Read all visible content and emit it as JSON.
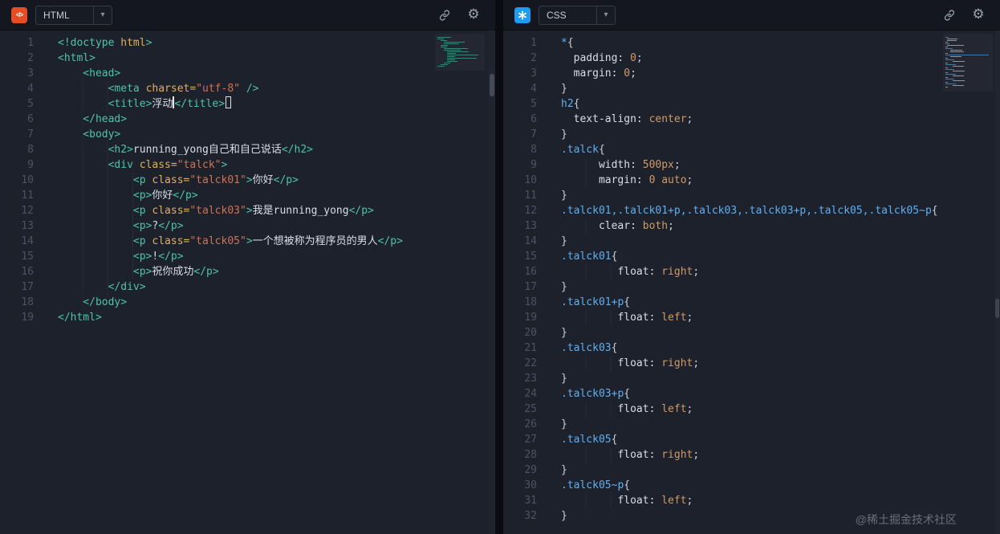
{
  "watermark": "@稀土掘金技术社区",
  "colors": {
    "editor_bg": "#1d212b",
    "header_bg": "#14171f",
    "splitter": "#0a0c11",
    "html_icon_bg": "#e44d26",
    "css_icon_bg": "#1f9cf0",
    "line_number": "#4b5364",
    "tokens": {
      "tag": "#4fc3a8",
      "attr": "#e0b05e",
      "str": "#ce7354",
      "text": "#d8dde8",
      "sel": "#61afef",
      "prop": "#d8dde8",
      "val": "#d19a66",
      "punc": "#c8cfdb"
    }
  },
  "icons": {
    "chevron": "▾",
    "gear": "⚙",
    "html_glyph": "</>"
  },
  "left_panel": {
    "header": {
      "language_label": "HTML"
    },
    "code_lines": [
      {
        "indent": 0,
        "tokens": [
          {
            "t": "tag",
            "s": "<!doctype "
          },
          {
            "t": "attr",
            "s": "html"
          },
          {
            "t": "tag",
            "s": ">"
          }
        ]
      },
      {
        "indent": 0,
        "tokens": [
          {
            "t": "tag",
            "s": "<html>"
          }
        ]
      },
      {
        "indent": 4,
        "tokens": [
          {
            "t": "tag",
            "s": "<head>"
          }
        ]
      },
      {
        "indent": 8,
        "tokens": [
          {
            "t": "tag",
            "s": "<meta "
          },
          {
            "t": "attr",
            "s": "charset="
          },
          {
            "t": "str",
            "s": "\"utf-8\""
          },
          {
            "t": "tag",
            "s": " />"
          }
        ]
      },
      {
        "indent": 8,
        "tokens": [
          {
            "t": "tag",
            "s": "<title>"
          },
          {
            "t": "text",
            "s": "浮动"
          },
          {
            "t": "caret"
          },
          {
            "t": "tag",
            "s": "</title>"
          },
          {
            "t": "cursorbox"
          }
        ]
      },
      {
        "indent": 4,
        "tokens": [
          {
            "t": "tag",
            "s": "</head>"
          }
        ]
      },
      {
        "indent": 4,
        "tokens": [
          {
            "t": "tag",
            "s": "<body>"
          }
        ]
      },
      {
        "indent": 8,
        "tokens": [
          {
            "t": "tag",
            "s": "<h2>"
          },
          {
            "t": "text",
            "s": "running_yong自己和自己说话"
          },
          {
            "t": "tag",
            "s": "</h2>"
          }
        ]
      },
      {
        "indent": 8,
        "tokens": [
          {
            "t": "tag",
            "s": "<div "
          },
          {
            "t": "attr",
            "s": "class="
          },
          {
            "t": "str",
            "s": "\"talck\""
          },
          {
            "t": "tag",
            "s": ">"
          }
        ]
      },
      {
        "indent": 12,
        "tokens": [
          {
            "t": "tag",
            "s": "<p "
          },
          {
            "t": "attr",
            "s": "class="
          },
          {
            "t": "str",
            "s": "\"talck01\""
          },
          {
            "t": "tag",
            "s": ">"
          },
          {
            "t": "text",
            "s": "你好"
          },
          {
            "t": "tag",
            "s": "</p>"
          }
        ]
      },
      {
        "indent": 12,
        "tokens": [
          {
            "t": "tag",
            "s": "<p>"
          },
          {
            "t": "text",
            "s": "你好"
          },
          {
            "t": "tag",
            "s": "</p>"
          }
        ]
      },
      {
        "indent": 12,
        "tokens": [
          {
            "t": "tag",
            "s": "<p "
          },
          {
            "t": "attr",
            "s": "class="
          },
          {
            "t": "str",
            "s": "\"talck03\""
          },
          {
            "t": "tag",
            "s": ">"
          },
          {
            "t": "text",
            "s": "我是running_yong"
          },
          {
            "t": "tag",
            "s": "</p>"
          }
        ]
      },
      {
        "indent": 12,
        "tokens": [
          {
            "t": "tag",
            "s": "<p>"
          },
          {
            "t": "text",
            "s": "?"
          },
          {
            "t": "tag",
            "s": "</p>"
          }
        ]
      },
      {
        "indent": 12,
        "tokens": [
          {
            "t": "tag",
            "s": "<p "
          },
          {
            "t": "attr",
            "s": "class="
          },
          {
            "t": "str",
            "s": "\"talck05\""
          },
          {
            "t": "tag",
            "s": ">"
          },
          {
            "t": "text",
            "s": "一个想被称为程序员的男人"
          },
          {
            "t": "tag",
            "s": "</p>"
          }
        ]
      },
      {
        "indent": 12,
        "tokens": [
          {
            "t": "tag",
            "s": "<p>"
          },
          {
            "t": "text",
            "s": "!"
          },
          {
            "t": "tag",
            "s": "</p>"
          }
        ]
      },
      {
        "indent": 12,
        "tokens": [
          {
            "t": "tag",
            "s": "<p>"
          },
          {
            "t": "text",
            "s": "祝你成功"
          },
          {
            "t": "tag",
            "s": "</p>"
          }
        ]
      },
      {
        "indent": 8,
        "tokens": [
          {
            "t": "tag",
            "s": "</div>"
          }
        ]
      },
      {
        "indent": 4,
        "tokens": [
          {
            "t": "tag",
            "s": "</body>"
          }
        ]
      },
      {
        "indent": 0,
        "tokens": [
          {
            "t": "tag",
            "s": "</html>"
          }
        ]
      }
    ]
  },
  "right_panel": {
    "header": {
      "language_label": "CSS"
    },
    "code_lines": [
      {
        "indent": 0,
        "tokens": [
          {
            "t": "sel",
            "s": "*"
          },
          {
            "t": "punc",
            "s": "{"
          }
        ]
      },
      {
        "indent": 2,
        "tokens": [
          {
            "t": "prop",
            "s": "padding: "
          },
          {
            "t": "val",
            "s": "0"
          },
          {
            "t": "punc",
            "s": ";"
          }
        ]
      },
      {
        "indent": 2,
        "tokens": [
          {
            "t": "prop",
            "s": "margin: "
          },
          {
            "t": "val",
            "s": "0"
          },
          {
            "t": "punc",
            "s": ";"
          }
        ]
      },
      {
        "indent": 0,
        "tokens": [
          {
            "t": "punc",
            "s": "}"
          }
        ]
      },
      {
        "indent": 0,
        "tokens": [
          {
            "t": "sel",
            "s": "h2"
          },
          {
            "t": "punc",
            "s": "{"
          }
        ]
      },
      {
        "indent": 2,
        "tokens": [
          {
            "t": "prop",
            "s": "text-align: "
          },
          {
            "t": "val",
            "s": "center"
          },
          {
            "t": "punc",
            "s": ";"
          }
        ]
      },
      {
        "indent": 0,
        "tokens": [
          {
            "t": "punc",
            "s": "}"
          }
        ]
      },
      {
        "indent": 0,
        "tokens": [
          {
            "t": "sel",
            "s": ".talck"
          },
          {
            "t": "punc",
            "s": "{"
          }
        ]
      },
      {
        "indent": 6,
        "tokens": [
          {
            "t": "prop",
            "s": "width: "
          },
          {
            "t": "val",
            "s": "500px"
          },
          {
            "t": "punc",
            "s": ";"
          }
        ]
      },
      {
        "indent": 6,
        "tokens": [
          {
            "t": "prop",
            "s": "margin: "
          },
          {
            "t": "val",
            "s": "0 auto"
          },
          {
            "t": "punc",
            "s": ";"
          }
        ]
      },
      {
        "indent": 0,
        "tokens": [
          {
            "t": "punc",
            "s": "}"
          }
        ]
      },
      {
        "indent": 0,
        "tokens": [
          {
            "t": "sel",
            "s": ".talck01,.talck01+p,.talck03,.talck03+p,.talck05,.talck05~p"
          },
          {
            "t": "punc",
            "s": "{"
          }
        ]
      },
      {
        "indent": 6,
        "tokens": [
          {
            "t": "prop",
            "s": "clear: "
          },
          {
            "t": "val",
            "s": "both"
          },
          {
            "t": "punc",
            "s": ";"
          }
        ]
      },
      {
        "indent": 0,
        "tokens": [
          {
            "t": "punc",
            "s": "}"
          }
        ]
      },
      {
        "indent": 0,
        "tokens": [
          {
            "t": "sel",
            "s": ".talck01"
          },
          {
            "t": "punc",
            "s": "{"
          }
        ]
      },
      {
        "indent": 9,
        "tokens": [
          {
            "t": "prop",
            "s": "float: "
          },
          {
            "t": "val",
            "s": "right"
          },
          {
            "t": "punc",
            "s": ";"
          }
        ]
      },
      {
        "indent": 0,
        "tokens": [
          {
            "t": "punc",
            "s": "}"
          }
        ]
      },
      {
        "indent": 0,
        "tokens": [
          {
            "t": "sel",
            "s": ".talck01+p"
          },
          {
            "t": "punc",
            "s": "{"
          }
        ]
      },
      {
        "indent": 9,
        "tokens": [
          {
            "t": "prop",
            "s": "float: "
          },
          {
            "t": "val",
            "s": "left"
          },
          {
            "t": "punc",
            "s": ";"
          }
        ]
      },
      {
        "indent": 0,
        "tokens": [
          {
            "t": "punc",
            "s": "}"
          }
        ]
      },
      {
        "indent": 0,
        "tokens": [
          {
            "t": "sel",
            "s": ".talck03"
          },
          {
            "t": "punc",
            "s": "{"
          }
        ]
      },
      {
        "indent": 9,
        "tokens": [
          {
            "t": "prop",
            "s": "float: "
          },
          {
            "t": "val",
            "s": "right"
          },
          {
            "t": "punc",
            "s": ";"
          }
        ]
      },
      {
        "indent": 0,
        "tokens": [
          {
            "t": "punc",
            "s": "}"
          }
        ]
      },
      {
        "indent": 0,
        "tokens": [
          {
            "t": "sel",
            "s": ".talck03+p"
          },
          {
            "t": "punc",
            "s": "{"
          }
        ]
      },
      {
        "indent": 9,
        "tokens": [
          {
            "t": "prop",
            "s": "float: "
          },
          {
            "t": "val",
            "s": "left"
          },
          {
            "t": "punc",
            "s": ";"
          }
        ]
      },
      {
        "indent": 0,
        "tokens": [
          {
            "t": "punc",
            "s": "}"
          }
        ]
      },
      {
        "indent": 0,
        "tokens": [
          {
            "t": "sel",
            "s": ".talck05"
          },
          {
            "t": "punc",
            "s": "{"
          }
        ]
      },
      {
        "indent": 9,
        "tokens": [
          {
            "t": "prop",
            "s": "float: "
          },
          {
            "t": "val",
            "s": "right"
          },
          {
            "t": "punc",
            "s": ";"
          }
        ]
      },
      {
        "indent": 0,
        "tokens": [
          {
            "t": "punc",
            "s": "}"
          }
        ]
      },
      {
        "indent": 0,
        "tokens": [
          {
            "t": "sel",
            "s": ".talck05~p"
          },
          {
            "t": "punc",
            "s": "{"
          }
        ]
      },
      {
        "indent": 9,
        "tokens": [
          {
            "t": "prop",
            "s": "float: "
          },
          {
            "t": "val",
            "s": "left"
          },
          {
            "t": "punc",
            "s": ";"
          }
        ]
      },
      {
        "indent": 0,
        "tokens": [
          {
            "t": "punc",
            "s": "}"
          }
        ]
      }
    ]
  }
}
